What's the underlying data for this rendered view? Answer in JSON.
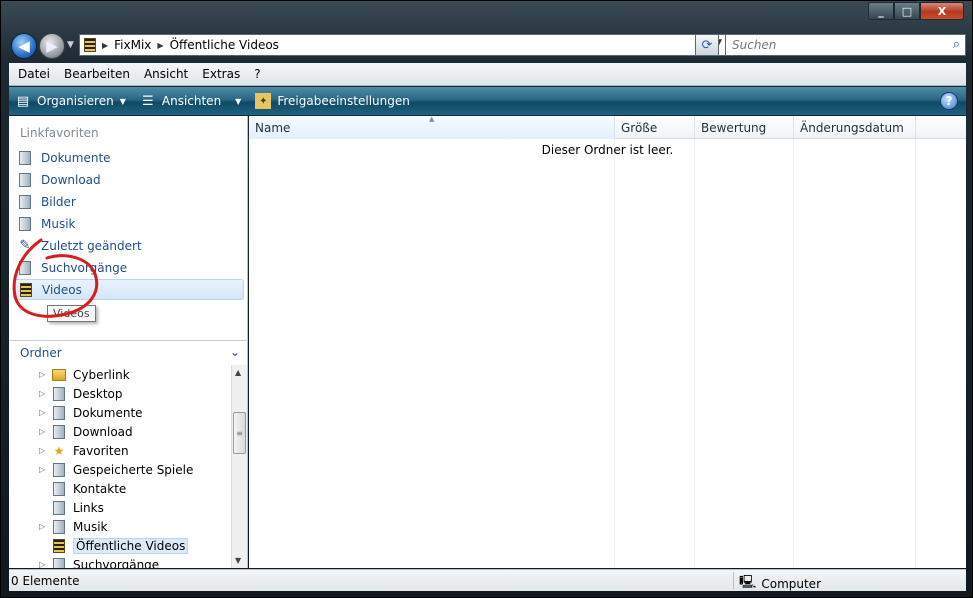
{
  "window": {
    "controls": {
      "minimize": "_",
      "maximize": "□",
      "close": "X"
    }
  },
  "nav": {
    "back_icon": "arrow-left-icon",
    "forward_icon": "arrow-right-icon",
    "breadcrumb": [
      "FixMix",
      "Öffentliche Videos"
    ],
    "search_placeholder": "Suchen"
  },
  "menu": [
    "Datei",
    "Bearbeiten",
    "Ansicht",
    "Extras",
    "?"
  ],
  "toolbar": {
    "organize": "Organisieren",
    "views": "Ansichten",
    "share": "Freigabeeinstellungen"
  },
  "favorites": {
    "title": "Linkfavoriten",
    "items": [
      "Dokumente",
      "Download",
      "Bilder",
      "Musik",
      "Zuletzt geändert",
      "Suchvorgänge",
      "Videos"
    ],
    "selected": "Videos",
    "tooltip": "Videos"
  },
  "folders": {
    "title": "Ordner",
    "items": [
      "Cyberlink",
      "Desktop",
      "Dokumente",
      "Download",
      "Favoriten",
      "Gespeicherte Spiele",
      "Kontakte",
      "Links",
      "Musik",
      "Öffentliche Videos",
      "Suchvorgänge"
    ],
    "selected": "Öffentliche Videos"
  },
  "columns": [
    "Name",
    "Größe",
    "Bewertung",
    "Änderungsdatum"
  ],
  "empty_message": "Dieser Ordner ist leer.",
  "status": {
    "count": "0 Elemente",
    "location": "Computer"
  },
  "colors": {
    "annotation": "#d81c1c",
    "toolbar": "#2a6783",
    "link": "#1e4f8c"
  }
}
